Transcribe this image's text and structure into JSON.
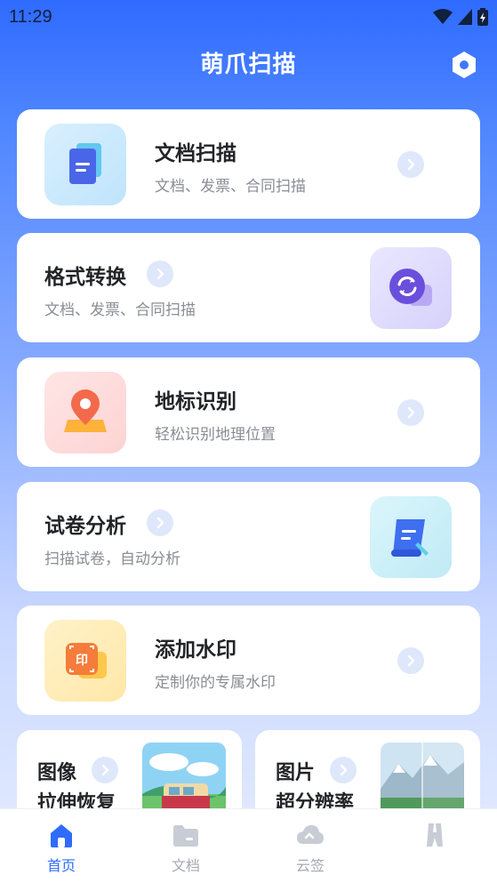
{
  "status": {
    "time": "11:29"
  },
  "header": {
    "title": "萌爪扫描"
  },
  "cards": [
    {
      "title": "文档扫描",
      "subtitle": "文档、发票、合同扫描",
      "icon": "document-icon"
    },
    {
      "title": "格式转换",
      "subtitle": "文档、发票、合同扫描",
      "icon": "convert-icon"
    },
    {
      "title": "地标识别",
      "subtitle": "轻松识别地理位置",
      "icon": "location-pin-icon"
    },
    {
      "title": "试卷分析",
      "subtitle": "扫描试卷，自动分析",
      "icon": "scroll-icon"
    },
    {
      "title": "添加水印",
      "subtitle": "定制你的专属水印",
      "icon": "watermark-icon"
    }
  ],
  "small_cards": [
    {
      "line1": "图像",
      "line2": "拉伸恢复"
    },
    {
      "line1": "图片",
      "line2": "超分辨率"
    }
  ],
  "tabs": [
    {
      "label": "首页",
      "icon": "home-icon",
      "active": true
    },
    {
      "label": "文档",
      "icon": "folder-icon",
      "active": false
    },
    {
      "label": "云签",
      "icon": "cloud-icon",
      "active": false
    },
    {
      "label": "",
      "icon": "profile-icon",
      "active": false
    }
  ],
  "colors": {
    "primary": "#2f6bff",
    "card_bg": "#ffffff",
    "title_text": "#222428",
    "subtitle_text": "#8a8d94",
    "inactive_tab": "#a5a9b2"
  }
}
